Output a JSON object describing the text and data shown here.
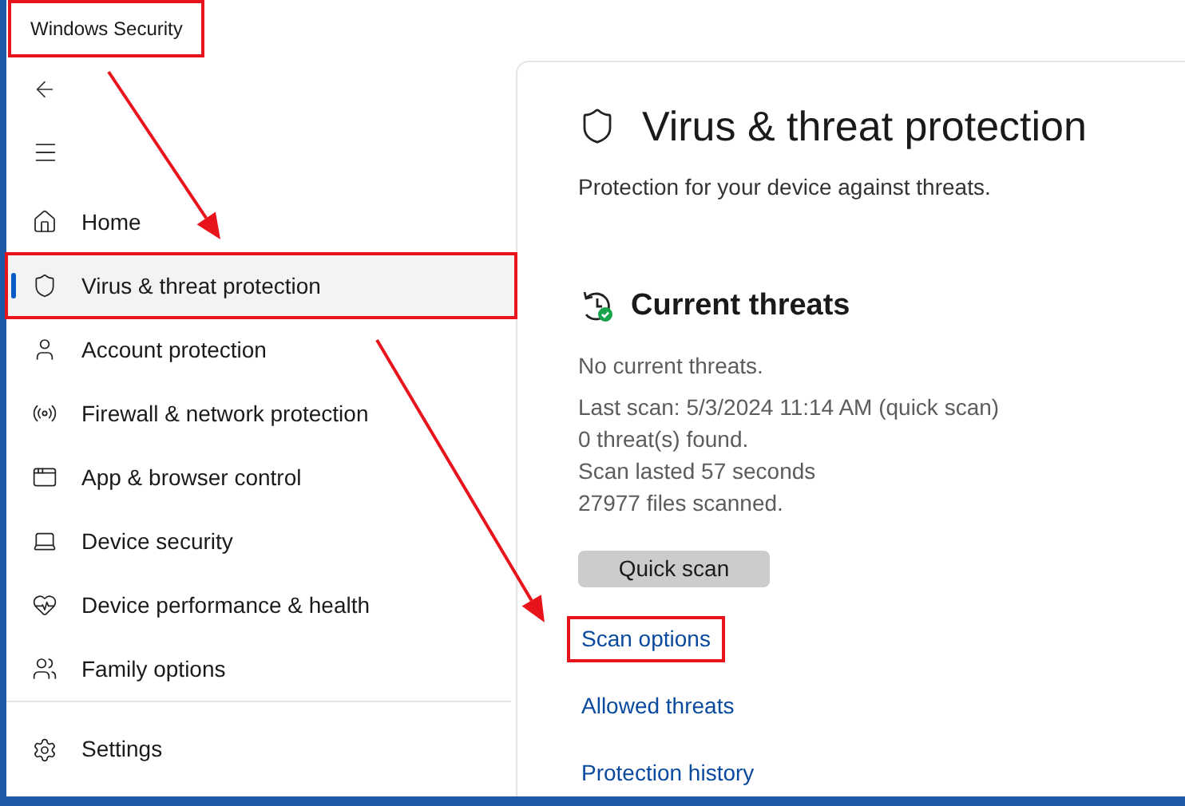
{
  "window": {
    "title": "Windows Security",
    "highlighted": true
  },
  "sidebar": {
    "items": [
      {
        "label": "Home",
        "selected": false,
        "highlighted": false
      },
      {
        "label": "Virus & threat protection",
        "selected": true,
        "highlighted": true
      },
      {
        "label": "Account protection",
        "selected": false,
        "highlighted": false
      },
      {
        "label": "Firewall & network protection",
        "selected": false,
        "highlighted": false
      },
      {
        "label": "App & browser control",
        "selected": false,
        "highlighted": false
      },
      {
        "label": "Device security",
        "selected": false,
        "highlighted": false
      },
      {
        "label": "Device performance & health",
        "selected": false,
        "highlighted": false
      },
      {
        "label": "Family options",
        "selected": false,
        "highlighted": false
      }
    ],
    "settings": "Settings"
  },
  "page": {
    "title": "Virus & threat protection",
    "description": "Protection for your device against threats.",
    "section": {
      "title": "Current threats",
      "lines": [
        "No current threats.",
        "Last scan: 5/3/2024 11:14 AM (quick scan)",
        "0 threat(s) found.",
        "Scan lasted 57 seconds",
        "27977 files scanned."
      ],
      "button": "Quick scan"
    },
    "links": [
      {
        "label": "Scan options",
        "highlighted": true
      },
      {
        "label": "Allowed threats",
        "highlighted": false
      },
      {
        "label": "Protection history",
        "highlighted": false
      }
    ]
  }
}
